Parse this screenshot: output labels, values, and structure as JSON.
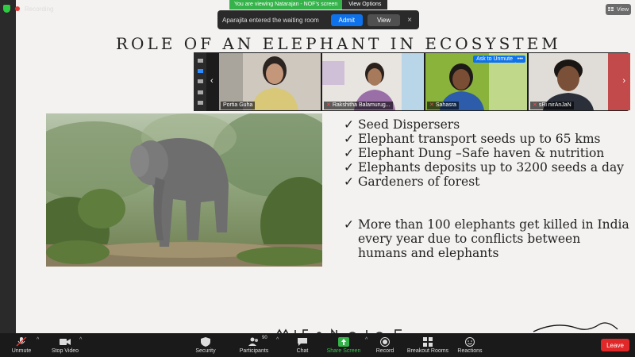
{
  "top_status": {
    "title": "Recording"
  },
  "share_banner": {
    "text": "You are viewing Natarajan - NOF's screen",
    "view_options": "View Options"
  },
  "top_view_button": "View",
  "waiting_room": {
    "message": "Aparajita entered the waiting room",
    "admit": "Admit",
    "view": "View",
    "close": "×"
  },
  "slide": {
    "title": "ROLE OF AN ELEPHANT IN ECOSYSTEM",
    "bullets_1": [
      "Seed Dispersers",
      "Elephant transport seeds up to 65 kms",
      "Elephant Dung –Safe haven & nutrition",
      "Elephants deposits up to 3200 seeds a day",
      "Gardeners of forest"
    ],
    "bullets_2": [
      "More than 100 elephants get killed in India every year due to conflicts between humans and elephants"
    ],
    "check": "✓"
  },
  "gallery": {
    "participants": [
      {
        "name": "Portia Guha",
        "muted": false
      },
      {
        "name": "Rakshitha Balamurug...",
        "muted": true
      },
      {
        "name": "Sahasra",
        "muted": true
      },
      {
        "name": "sRi nirAnJaN",
        "muted": true
      }
    ],
    "ask_to_unmute": "Ask to Unmute",
    "more": "•••",
    "prev": "‹",
    "next": "›"
  },
  "toolbar": {
    "unmute": "Unmute",
    "stop_video": "Stop Video",
    "security": "Security",
    "participants": "Participants",
    "participants_count": "90",
    "chat": "Chat",
    "share_screen": "Share Screen",
    "record": "Record",
    "breakout_rooms": "Breakout Rooms",
    "reactions": "Reactions",
    "leave": "Leave",
    "caret": "^"
  },
  "colors": {
    "zoom_blue": "#0e72ed",
    "share_green": "#35b34a",
    "leave_red": "#e02828"
  }
}
